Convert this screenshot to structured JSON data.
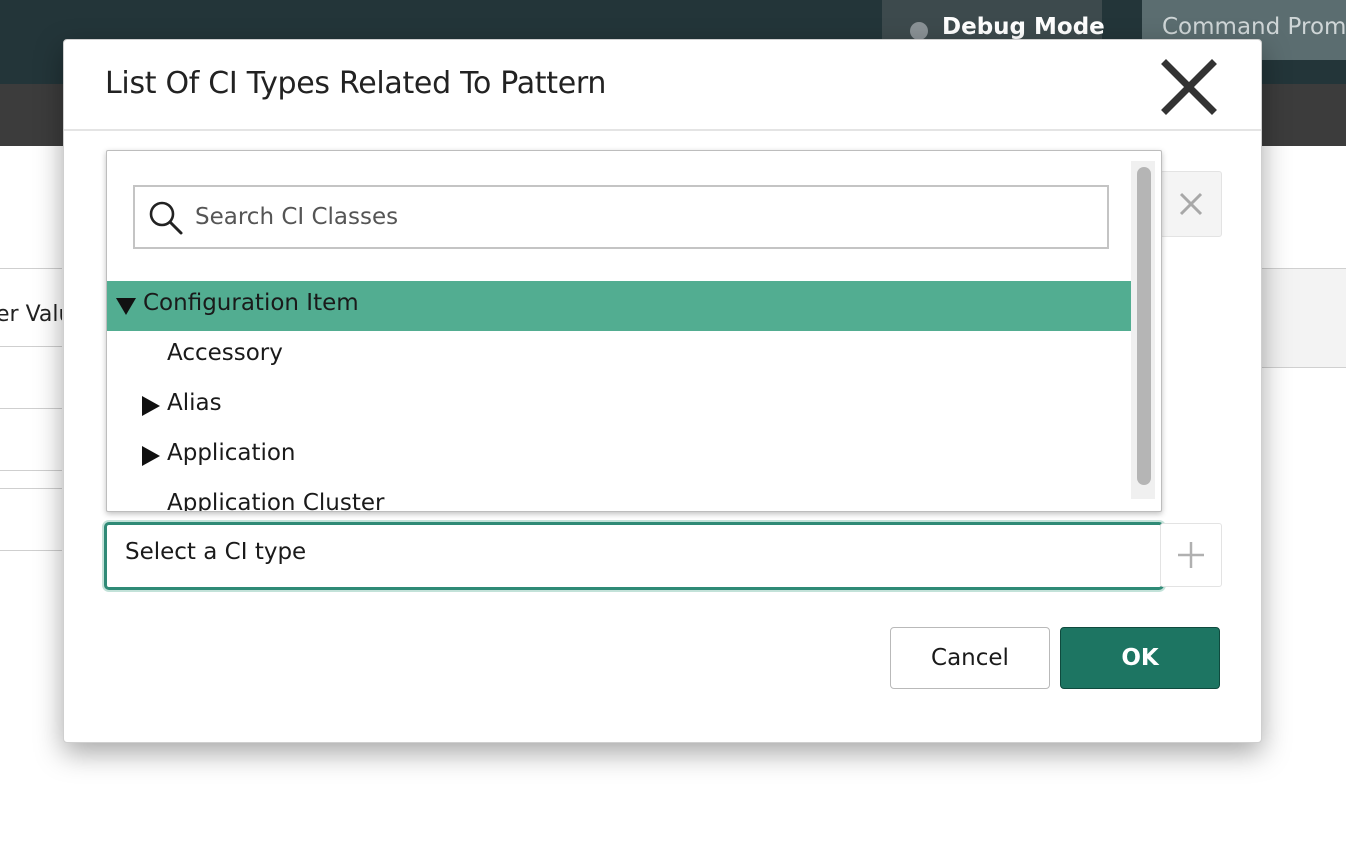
{
  "app": {
    "debug_mode_label": "Debug Mode",
    "command_prompt_label": "Command Promp",
    "bg_column_header": "er Valu"
  },
  "modal": {
    "title": "List Of CI Types Related To Pattern",
    "close_icon": "close-icon",
    "search": {
      "placeholder": "Search CI Classes",
      "value": ""
    },
    "tree": [
      {
        "label": "Configuration Item",
        "expanded": true,
        "selected": true,
        "has_children": true,
        "level": 0
      },
      {
        "label": "Accessory",
        "expanded": false,
        "selected": false,
        "has_children": false,
        "level": 1
      },
      {
        "label": "Alias",
        "expanded": false,
        "selected": false,
        "has_children": true,
        "level": 1
      },
      {
        "label": "Application",
        "expanded": false,
        "selected": false,
        "has_children": true,
        "level": 1
      },
      {
        "label": "Application Cluster",
        "expanded": false,
        "selected": false,
        "has_children": false,
        "level": 1
      }
    ],
    "ci_type_select": {
      "value": "Select a CI type"
    },
    "buttons": {
      "cancel_label": "Cancel",
      "ok_label": "OK"
    }
  },
  "colors": {
    "topbar": "#233539",
    "selected_row": "#52ad91",
    "ok_button": "#1d7562",
    "focus_border": "#2f8a76"
  }
}
